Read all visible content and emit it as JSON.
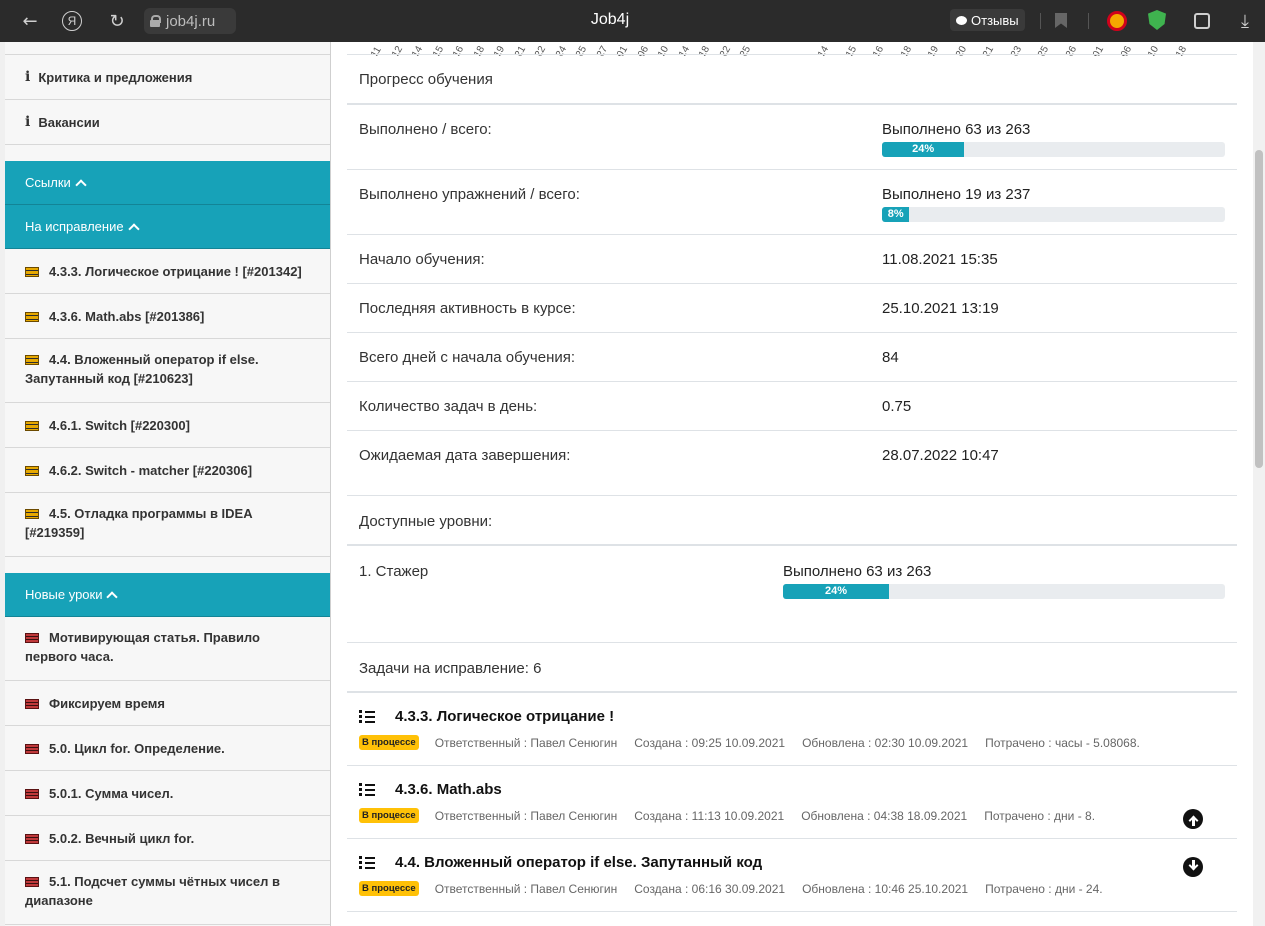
{
  "browser": {
    "url": "job4j.ru",
    "title": "Job4j",
    "reviews_label": "Отзывы"
  },
  "sidebar": {
    "top_items": [
      {
        "label": "Критика и предложения"
      },
      {
        "label": "Вакансии"
      }
    ],
    "links_header": "Ссылки",
    "fix_header": "На исправление",
    "fix_items": [
      {
        "line1": "4.3.3. Логическое отрицание ! [#201342]",
        "line2": ""
      },
      {
        "line1": "4.3.6. Math.abs [#201386]",
        "line2": ""
      },
      {
        "line1": "4.4. Вложенный оператор if else.",
        "line2": "Запутанный код [#210623]"
      },
      {
        "line1": "4.6.1. Switch [#220300]",
        "line2": ""
      },
      {
        "line1": "4.6.2. Switch - matcher [#220306]",
        "line2": ""
      },
      {
        "line1": "4.5. Отладка программы в IDEA",
        "line2": "[#219359]"
      }
    ],
    "new_header": "Новые уроки",
    "new_items": [
      {
        "line1": "Мотивирующая статья. Правило",
        "line2": "первого часа."
      },
      {
        "line1": "Фиксируем время",
        "line2": ""
      },
      {
        "line1": "5.0. Цикл for. Определение.",
        "line2": ""
      },
      {
        "line1": "5.0.1. Сумма чисел.",
        "line2": ""
      },
      {
        "line1": "5.0.2. Вечный цикл for.",
        "line2": ""
      },
      {
        "line1": "5.1. Подсчет суммы чётных чисел в",
        "line2": "диапазоне"
      }
    ]
  },
  "chart_ticks": {
    "left": [
      "11",
      "12",
      "14",
      "15",
      "16",
      "18",
      "19",
      "21",
      "22",
      "24",
      "25",
      "27",
      "01",
      "06",
      "10",
      "14",
      "18",
      "22",
      "25"
    ],
    "right": [
      "14",
      "15",
      "16",
      "18",
      "19",
      "20",
      "21",
      "23",
      "25",
      "26",
      "01",
      "06",
      "10",
      "18"
    ]
  },
  "progress": {
    "title": "Прогресс обучения",
    "rows": {
      "done_total": {
        "label": "Выполнено / всего:",
        "value": "Выполнено 63 из 263",
        "percent": 24,
        "percent_label": "24%"
      },
      "exercises": {
        "label": "Выполнено упражнений / всего:",
        "value": "Выполнено 19 из 237",
        "percent": 8,
        "percent_label": "8%"
      },
      "start": {
        "label": "Начало обучения:",
        "value": "11.08.2021 15:35"
      },
      "last_activity": {
        "label": "Последняя активность в курсе:",
        "value": "25.10.2021 13:19"
      },
      "days": {
        "label": "Всего дней с начала обучения:",
        "value": "84"
      },
      "per_day": {
        "label": "Количество задач в день:",
        "value": "0.75"
      },
      "expected": {
        "label": "Ожидаемая дата завершения:",
        "value": "28.07.2022 10:47"
      }
    }
  },
  "levels": {
    "title": "Доступные уровни:",
    "items": [
      {
        "name": "1. Стажер",
        "value": "Выполнено 63 из 263",
        "percent": 24,
        "percent_label": "24%"
      }
    ]
  },
  "tasks": {
    "title": "Задачи на исправление: 6",
    "items": [
      {
        "title": "4.3.3. Логическое отрицание !",
        "status": "В процессе",
        "responsible": "Ответственный : Павел Сенюгин",
        "created": "Создана : 09:25 10.09.2021",
        "updated": "Обновлена : 02:30 10.09.2021",
        "spent": "Потрачено : часы - 5.08068."
      },
      {
        "title": "4.3.6. Math.abs",
        "status": "В процессе",
        "responsible": "Ответственный : Павел Сенюгин",
        "created": "Создана : 11:13 10.09.2021",
        "updated": "Обновлена : 04:38 18.09.2021",
        "spent": "Потрачено : дни - 8."
      },
      {
        "title": "4.4. Вложенный оператор if else. Запутанный код",
        "status": "В процессе",
        "responsible": "Ответственный : Павел Сенюгин",
        "created": "Создана : 06:16 30.09.2021",
        "updated": "Обновлена : 10:46 25.10.2021",
        "spent": "Потрачено : дни - 24."
      }
    ]
  }
}
